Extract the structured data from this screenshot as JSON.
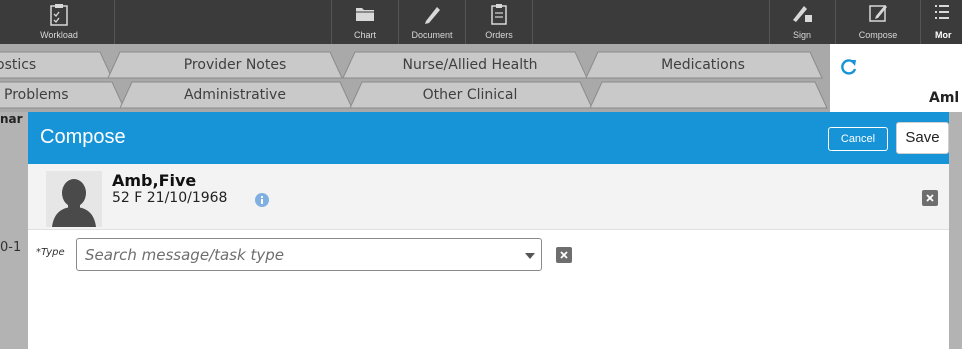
{
  "toolbar": {
    "workload": "Workload",
    "chart": "Chart",
    "document": "Document",
    "orders": "Orders",
    "sign": "Sign",
    "compose": "Compose",
    "more": "Mor"
  },
  "tabs": {
    "row1": [
      "ostics",
      "Provider Notes",
      "Nurse/Allied Health",
      "Medications"
    ],
    "row2": [
      "Problems",
      "Administrative",
      "Other Clinical"
    ]
  },
  "right_header_text": "Aml",
  "background": {
    "left_label": "nar",
    "left_text": "0-1"
  },
  "modal": {
    "title": "Compose",
    "cancel_label": "Cancel",
    "save_label": "Save",
    "patient": {
      "name": "Amb,Five",
      "info": "52 F 21/10/1968"
    },
    "type_label": "*Type",
    "type_placeholder": "Search message/task type"
  },
  "colors": {
    "header_blue": "#1694d7",
    "toolbar_dark": "#3b3b3b",
    "tab_bg": "#a9a9a9"
  }
}
